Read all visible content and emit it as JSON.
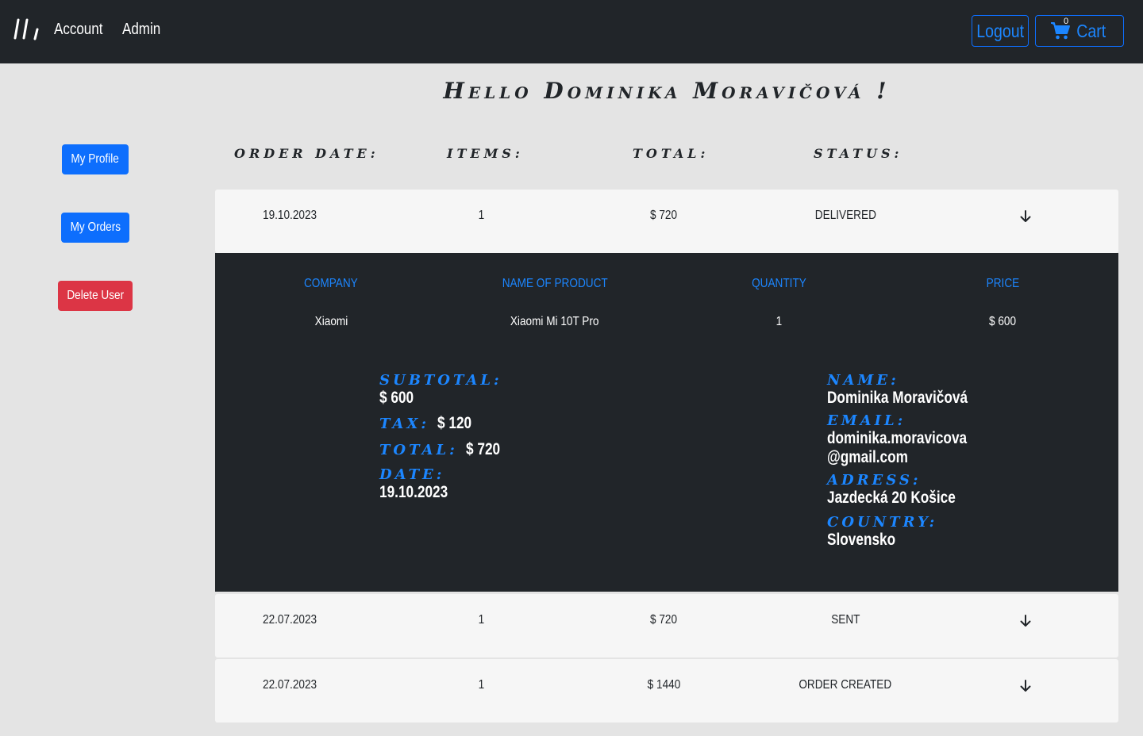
{
  "nav": {
    "links": [
      "Account",
      "Admin"
    ],
    "logout_label": "Logout",
    "cart_label": "Cart",
    "cart_count": "0"
  },
  "greeting": "Hello Dominika Moravičová !",
  "sidebar": {
    "profile": "My Profile",
    "orders": "My Orders",
    "delete": "Delete User"
  },
  "headers": {
    "date": "Order Date:",
    "items": "Items:",
    "total": "Total:",
    "status": "Status:"
  },
  "orders": [
    {
      "date": "19.10.2023",
      "items": "1",
      "total": "$ 720",
      "status": "DELIVERED"
    },
    {
      "date": "22.07.2023",
      "items": "1",
      "total": "$ 720",
      "status": "SENT"
    },
    {
      "date": "22.07.2023",
      "items": "1",
      "total": "$ 1440",
      "status": "ORDER CREATED"
    }
  ],
  "detail": {
    "columns": [
      "COMPANY",
      "NAME OF PRODUCT",
      "QUANTITY",
      "PRICE"
    ],
    "product": {
      "company": "Xiaomi",
      "name": "Xiaomi Mi 10T Pro",
      "quantity": "1",
      "price": "$ 600"
    },
    "summary": {
      "subtotal_label": "Subtotal:",
      "subtotal": "$ 600",
      "tax_label": "Tax:",
      "tax": "$ 120",
      "total_label": "Total:",
      "total": "$ 720",
      "date_label": "Date:",
      "date": "19.10.2023"
    },
    "customer": {
      "name_label": "Name:",
      "name": "Dominika Moravičová",
      "email_label": "Email:",
      "email_line1": "dominika.moravicova",
      "email_line2": "@gmail.com",
      "address_label": "Adress:",
      "address": "Jazdecká 20 Košice",
      "country_label": "Country:",
      "country": "Slovensko"
    }
  },
  "colors": {
    "navbar": "#212529",
    "primary": "#0d6efd",
    "danger": "#dc3545",
    "accent_text": "#1c86ff"
  }
}
